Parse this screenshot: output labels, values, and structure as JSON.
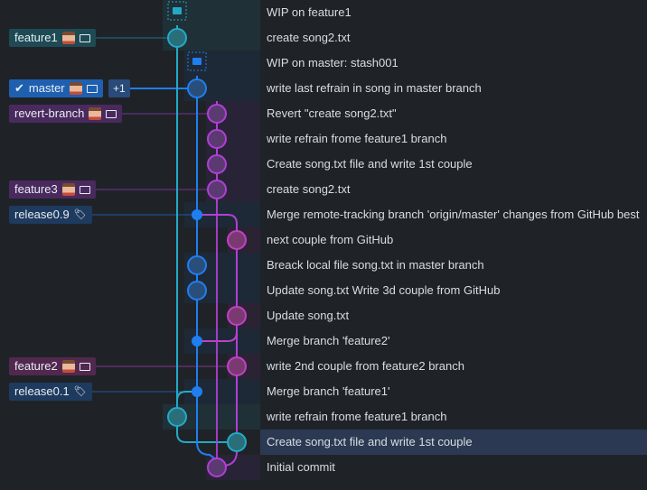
{
  "colors": {
    "bg": "#1f2328",
    "lane_cyan": "#23a9c7",
    "lane_blue": "#1f7ff0",
    "lane_purple": "#b03fd6",
    "lane_magenta": "#c040c8",
    "selected_row": "#2b3a52"
  },
  "labels": {
    "feature1": "feature1",
    "master": "master",
    "master_extra": "+1",
    "revert_branch": "revert-branch",
    "feature3": "feature3",
    "release09": "release0.9",
    "feature2": "feature2",
    "release01": "release0.1"
  },
  "icons": {
    "stash": "stash-icon",
    "laptop": "laptop-icon",
    "tag": "tag-icon",
    "check": "check-icon",
    "avatar": "avatar"
  },
  "commits": [
    {
      "message": "WIP on feature1"
    },
    {
      "message": "create song2.txt"
    },
    {
      "message": "WIP on master: stash001"
    },
    {
      "message": "write last refrain in song in master branch"
    },
    {
      "message": "Revert \"create song2.txt\""
    },
    {
      "message": "write refrain frome feature1 branch"
    },
    {
      "message": "Create song.txt file and write 1st couple"
    },
    {
      "message": "create song2.txt"
    },
    {
      "message": "Merge remote-tracking branch 'origin/master' changes from GitHub best"
    },
    {
      "message": "next couple from GitHub"
    },
    {
      "message": "Breack local file song.txt in master branch"
    },
    {
      "message": "Update song.txt Write 3d couple from GitHub"
    },
    {
      "message": "Update song.txt"
    },
    {
      "message": "Merge branch 'feature2'"
    },
    {
      "message": "write 2nd couple from feature2 branch"
    },
    {
      "message": "Merge branch 'feature1'"
    },
    {
      "message": "write refrain frome feature1 branch"
    },
    {
      "message": "Create song.txt file and write 1st couple"
    },
    {
      "message": "Initial commit"
    }
  ],
  "selected_index": 17
}
